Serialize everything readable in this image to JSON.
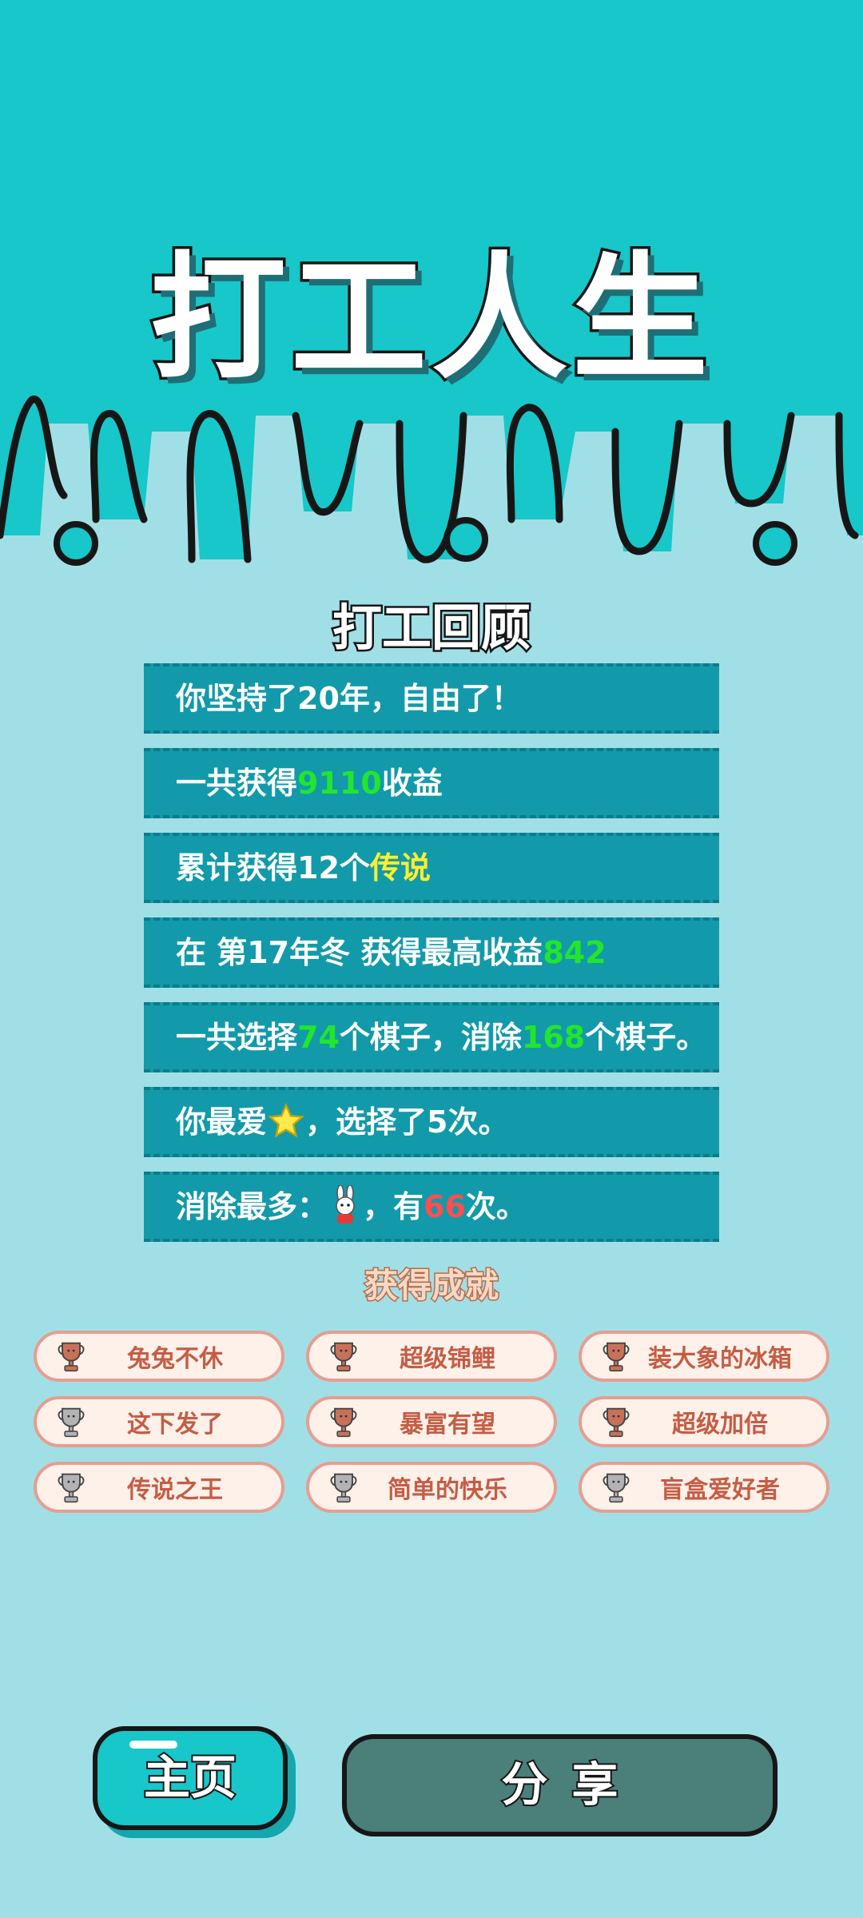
{
  "header": {
    "title": "打工人生"
  },
  "review": {
    "title": "打工回顾",
    "line1": {
      "text": "你坚持了20年，自由了！"
    },
    "line2": {
      "prefix": "一共获得",
      "value": "9110",
      "suffix": "收益"
    },
    "line3": {
      "prefix": "累计获得12个",
      "value": "传说"
    },
    "line4": {
      "prefix": "在 第17年冬 获得最高收益",
      "value": "842"
    },
    "line5": {
      "p1": "一共选择",
      "v1": "74",
      "p2": "个棋子，消除",
      "v2": "168",
      "p3": "个棋子。"
    },
    "line6": {
      "prefix": "你最爱",
      "suffix": "，选择了5次。",
      "icon": "star-icon"
    },
    "line7": {
      "prefix": "消除最多：",
      "p2": "，有",
      "value": "66",
      "suffix": "次。",
      "icon": "rabbit-icon"
    }
  },
  "achievements": {
    "title": "获得成就",
    "items": [
      {
        "label": "兔兔不休",
        "tier": "bronze"
      },
      {
        "label": "超级锦鲤",
        "tier": "bronze"
      },
      {
        "label": "装大象的冰箱",
        "tier": "bronze"
      },
      {
        "label": "这下发了",
        "tier": "silver"
      },
      {
        "label": "暴富有望",
        "tier": "bronze"
      },
      {
        "label": "超级加倍",
        "tier": "bronze"
      },
      {
        "label": "传说之王",
        "tier": "silver"
      },
      {
        "label": "简单的快乐",
        "tier": "silver"
      },
      {
        "label": "盲盒爱好者",
        "tier": "silver"
      }
    ]
  },
  "buttons": {
    "home": "主页",
    "share": "分享"
  },
  "colors": {
    "top": "#17c7c9",
    "background": "#a1dfe6",
    "row": "#129aaa",
    "green": "#22e62b",
    "yellow": "#ffef2e",
    "red": "#ff4e4e",
    "bronze": "#c8715a",
    "silver": "#b3b3b3"
  }
}
